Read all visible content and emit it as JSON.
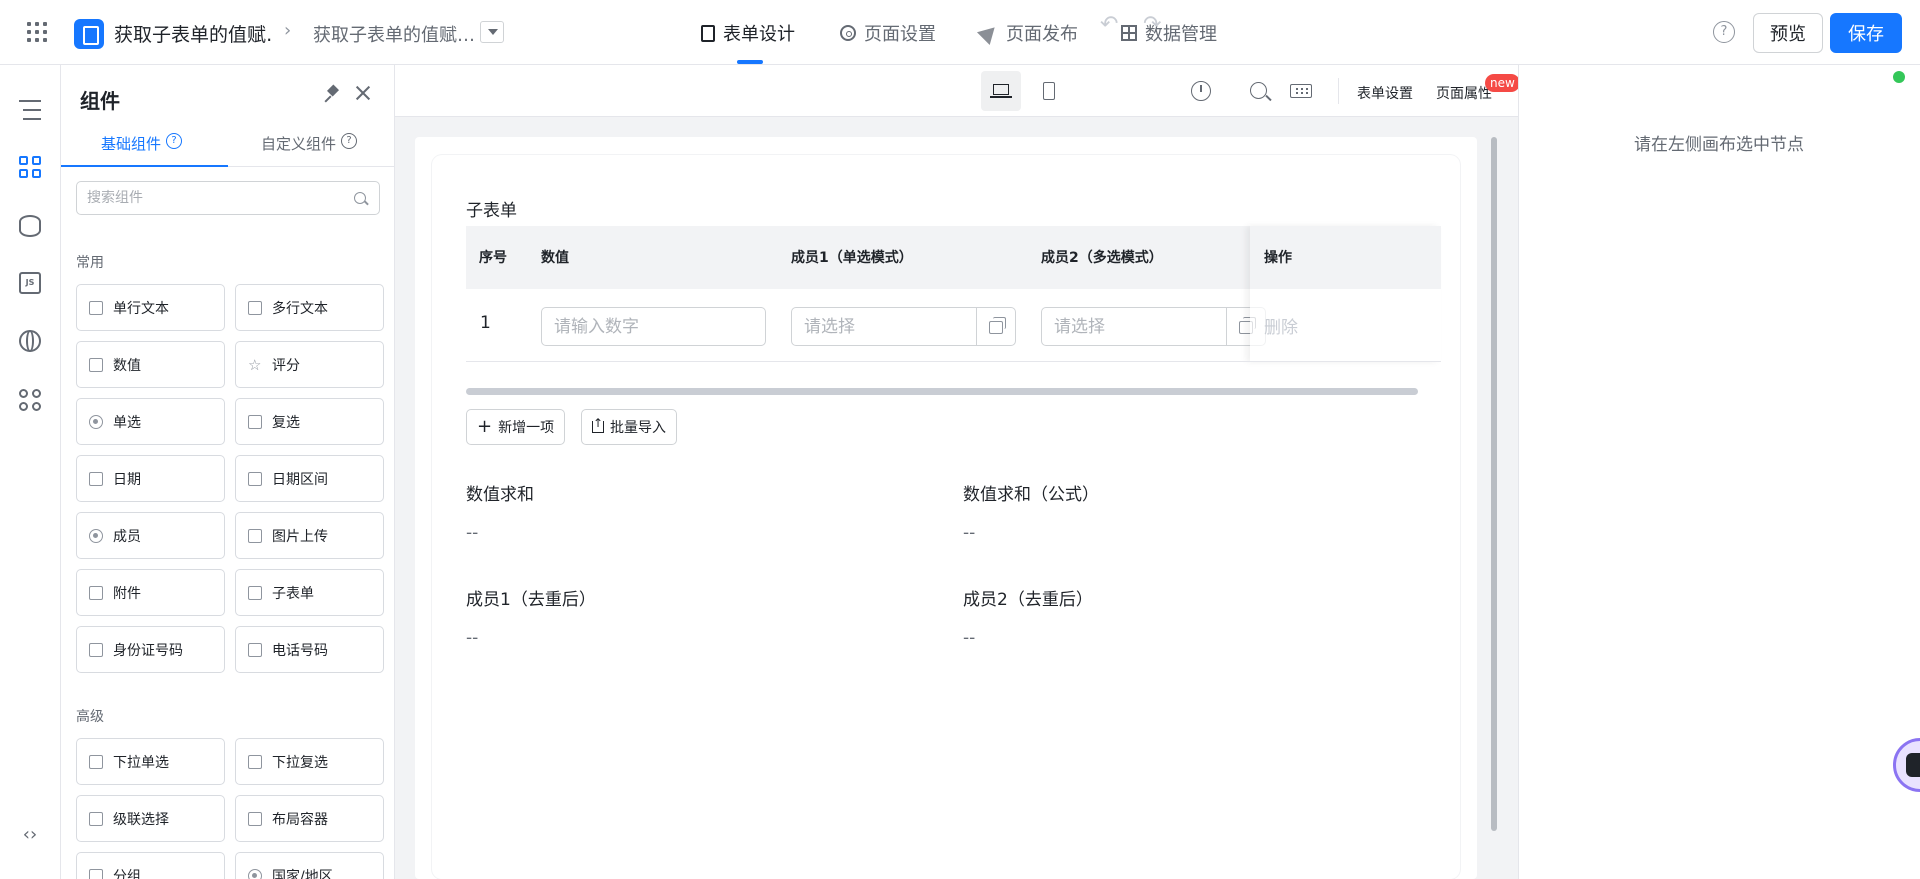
{
  "topbar": {
    "app_title": "获取子表单的值赋…",
    "page_title": "获取子表单的值赋…",
    "nav": [
      {
        "label": "表单设计",
        "icon": "document-icon",
        "active": true
      },
      {
        "label": "页面设置",
        "icon": "gear-icon",
        "active": false
      },
      {
        "label": "页面发布",
        "icon": "send-icon",
        "active": false
      },
      {
        "label": "数据管理",
        "icon": "table-icon",
        "active": false
      }
    ],
    "help": "?",
    "preview_label": "预览",
    "save_label": "保存",
    "accent_color": "#1677ff"
  },
  "rail": {
    "icons": [
      "outline-tree-icon",
      "components-grid-icon",
      "datasource-icon",
      "js-code-icon",
      "globe-icon",
      "apps-plugin-icon",
      "code-brackets-icon"
    ],
    "js_label": "JS",
    "code_label": "‹›"
  },
  "panel": {
    "title": "组件",
    "tabs": [
      {
        "label": "基础组件",
        "active": true
      },
      {
        "label": "自定义组件",
        "active": false
      }
    ],
    "search_placeholder": "搜索组件",
    "groups": [
      {
        "label": "常用",
        "items": [
          "单行文本",
          "多行文本",
          "数值",
          "评分",
          "单选",
          "复选",
          "日期",
          "日期区间",
          "成员",
          "图片上传",
          "附件",
          "子表单",
          "身份证号码",
          "电话号码"
        ]
      },
      {
        "label": "高级",
        "items": [
          "下拉单选",
          "下拉复选",
          "级联选择",
          "布局容器",
          "分组",
          "国家/地区"
        ]
      }
    ]
  },
  "canvas_toolbar": {
    "form_settings": "表单设置",
    "page_props": "页面属性",
    "new_badge": "new"
  },
  "form": {
    "subform_title": "子表单",
    "columns": [
      "序号",
      "数值",
      "成员1（单选模式）",
      "成员2（多选模式）",
      "操作"
    ],
    "row": {
      "index": "1",
      "number_placeholder": "请输入数字",
      "member1_placeholder": "请选择",
      "member2_placeholder": "请选择",
      "delete": "删除"
    },
    "add_item": "新增一项",
    "batch_import": "批量导入",
    "fields": [
      {
        "label": "数值求和",
        "value": "--"
      },
      {
        "label": "数值求和（公式）",
        "value": "--"
      },
      {
        "label": "成员1（去重后）",
        "value": "--"
      },
      {
        "label": "成员2（去重后）",
        "value": "--"
      }
    ]
  },
  "right_panel": {
    "hint": "请在左侧画布选中节点"
  }
}
